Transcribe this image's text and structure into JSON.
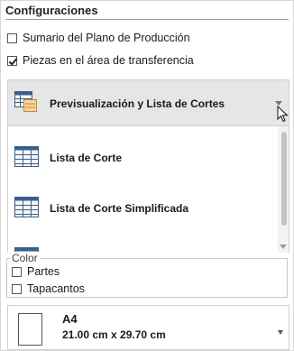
{
  "section": {
    "title": "Configuraciones"
  },
  "options": [
    {
      "label": "Sumario del Plano de Producción",
      "checked": false
    },
    {
      "label": "Piezas en el área de transferencia",
      "checked": true
    }
  ],
  "report_dropdown": {
    "selected": "Previsualización y Lista de Cortes",
    "items": [
      {
        "label": "Lista de Corte",
        "icon": "table-icon"
      },
      {
        "label": "Lista de Corte Simplificada",
        "icon": "table-icon"
      }
    ]
  },
  "color_group": {
    "legend": "Color",
    "options": [
      {
        "label": "Partes",
        "checked": false
      },
      {
        "label": "Tapacantos",
        "checked": false
      }
    ]
  },
  "paper": {
    "name": "A4",
    "size": "21.00 cm x 29.70 cm"
  }
}
